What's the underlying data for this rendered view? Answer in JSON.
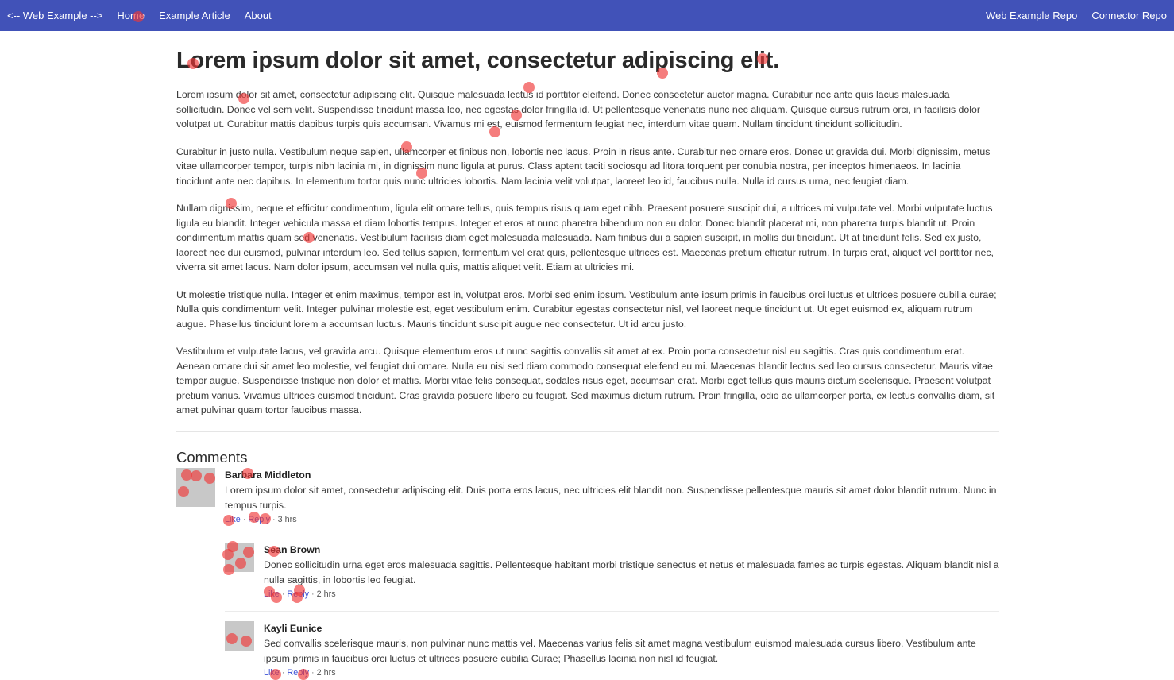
{
  "nav": {
    "brand": "<-- Web Example -->",
    "home": "Home",
    "example_article": "Example Article",
    "about": "About",
    "web_example_repo": "Web Example Repo",
    "connector_repo": "Connector Repo"
  },
  "article": {
    "title": "Lorem ipsum dolor sit amet, consectetur adipiscing elit.",
    "paragraphs": [
      "Lorem ipsum dolor sit amet, consectetur adipiscing elit. Quisque malesuada lectus id porttitor eleifend. Donec consectetur auctor magna. Curabitur nec ante quis lacus malesuada sollicitudin. Donec vel sem velit. Suspendisse tincidunt massa leo, nec egestas dolor fringilla id. Ut pellentesque venenatis nunc nec aliquam. Quisque cursus rutrum orci, in facilisis dolor volutpat ut. Curabitur mattis dapibus turpis quis accumsan. Vivamus mi est, euismod fermentum feugiat nec, interdum vitae quam. Nullam tincidunt tincidunt sollicitudin.",
      "Curabitur in justo nulla. Vestibulum neque sapien, ullamcorper et finibus non, lobortis nec lacus. Proin in risus ante. Curabitur nec ornare eros. Donec ut gravida dui. Morbi dignissim, metus vitae ullamcorper tempor, turpis nibh lacinia mi, in dignissim nunc ligula at purus. Class aptent taciti sociosqu ad litora torquent per conubia nostra, per inceptos himenaeos. In lacinia tincidunt ante nec dapibus. In elementum tortor quis nunc ultricies lobortis. Nam lacinia velit volutpat, laoreet leo id, faucibus nulla. Nulla id cursus urna, nec feugiat diam.",
      "Nullam dignissim, neque et efficitur condimentum, ligula elit ornare tellus, quis tempus risus quam eget nibh. Praesent posuere suscipit dui, a ultrices mi vulputate vel. Morbi vulputate luctus ligula eu blandit. Integer vehicula massa et diam lobortis tempus. Integer et eros at nunc pharetra bibendum non eu dolor. Donec blandit placerat mi, non pharetra turpis blandit ut. Proin condimentum mattis quam sed venenatis. Vestibulum facilisis diam eget malesuada malesuada. Nam finibus dui a sapien suscipit, in mollis dui tincidunt. Ut at tincidunt felis. Sed ex justo, laoreet nec dui euismod, pulvinar interdum leo. Sed tellus sapien, fermentum vel erat quis, pellentesque ultrices est. Maecenas pretium efficitur rutrum. In turpis erat, aliquet vel porttitor nec, viverra sit amet lacus. Nam dolor ipsum, accumsan vel nulla quis, mattis aliquet velit. Etiam at ultricies mi.",
      "Ut molestie tristique nulla. Integer et enim maximus, tempor est in, volutpat eros. Morbi sed enim ipsum. Vestibulum ante ipsum primis in faucibus orci luctus et ultrices posuere cubilia curae; Nulla quis condimentum velit. Integer pulvinar molestie est, eget vestibulum enim. Curabitur egestas consectetur nisl, vel laoreet neque tincidunt ut. Ut eget euismod ex, aliquam rutrum augue. Phasellus tincidunt lorem a accumsan luctus. Mauris tincidunt suscipit augue nec consectetur. Ut id arcu justo.",
      "Vestibulum et vulputate lacus, vel gravida arcu. Quisque elementum eros ut nunc sagittis convallis sit amet at ex. Proin porta consectetur nisl eu sagittis. Cras quis condimentum erat. Aenean ornare dui sit amet leo molestie, vel feugiat dui ornare. Nulla eu nisi sed diam commodo consequat eleifend eu mi. Maecenas blandit lectus sed leo cursus consectetur. Mauris vitae tempor augue. Suspendisse tristique non dolor et mattis. Morbi vitae felis consequat, sodales risus eget, accumsan erat. Morbi eget tellus quis mauris dictum scelerisque. Praesent volutpat pretium varius. Vivamus ultrices euismod tincidunt. Cras gravida posuere libero eu feugiat. Sed maximus dictum rutrum. Proin fringilla, odio ac ullamcorper porta, ex lectus convallis diam, sit amet pulvinar quam tortor faucibus massa."
    ]
  },
  "comments": {
    "heading": "Comments",
    "items": [
      {
        "author": "Barbara Middleton",
        "text": "Lorem ipsum dolor sit amet, consectetur adipiscing elit. Duis porta eros lacus, nec ultricies elit blandit non. Suspendisse pellentesque mauris sit amet dolor blandit rutrum. Nunc in tempus turpis.",
        "like": "Like",
        "reply": "Reply",
        "time": "3 hrs"
      },
      {
        "author": "Sean Brown",
        "text": "Donec sollicitudin urna eget eros malesuada sagittis. Pellentesque habitant morbi tristique senectus et netus et malesuada fames ac turpis egestas. Aliquam blandit nisl a nulla sagittis, in lobortis leo feugiat.",
        "like": "Like",
        "reply": "Reply",
        "time": "2 hrs"
      },
      {
        "author": "Kayli Eunice",
        "text": "Sed convallis scelerisque mauris, non pulvinar nunc mattis vel. Maecenas varius felis sit amet magna vestibulum euismod malesuada cursus libero. Vestibulum ante ipsum primis in faucibus orci luctus et ultrices posuere cubilia Curae; Phasellus lacinia non nisl id feugiat.",
        "like": "Like",
        "reply": "Reply",
        "time": "2 hrs"
      }
    ]
  },
  "meta_separator": "·",
  "colors": {
    "navbar": "#4152b8",
    "link": "#3d52d5",
    "avatar": "#c8c8c8",
    "marker": "#f03737"
  }
}
